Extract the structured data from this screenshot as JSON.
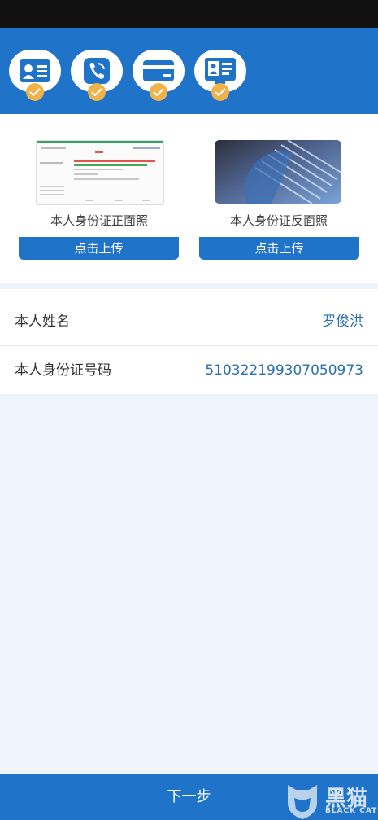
{
  "steps": [
    {
      "icon": "id-card-icon",
      "done": true
    },
    {
      "icon": "phone-icon",
      "done": true
    },
    {
      "icon": "bank-card-icon",
      "done": true
    },
    {
      "icon": "profile-card-icon",
      "done": true
    }
  ],
  "upload": {
    "front_label": "本人身份证正面照",
    "back_label": "本人身份证反面照",
    "front_button": "点击上传",
    "back_button": "点击上传"
  },
  "info": {
    "name_label": "本人姓名",
    "name_value": "罗俊洪",
    "id_label": "本人身份证号码",
    "id_value": "510322199307050973"
  },
  "footer": {
    "next_label": "下一步"
  },
  "watermark": {
    "text": "黑猫",
    "subtext": "BLACK CAT"
  },
  "colors": {
    "brand": "#1f73c9",
    "check": "#f0b24a",
    "value_text": "#2a6fb3"
  }
}
